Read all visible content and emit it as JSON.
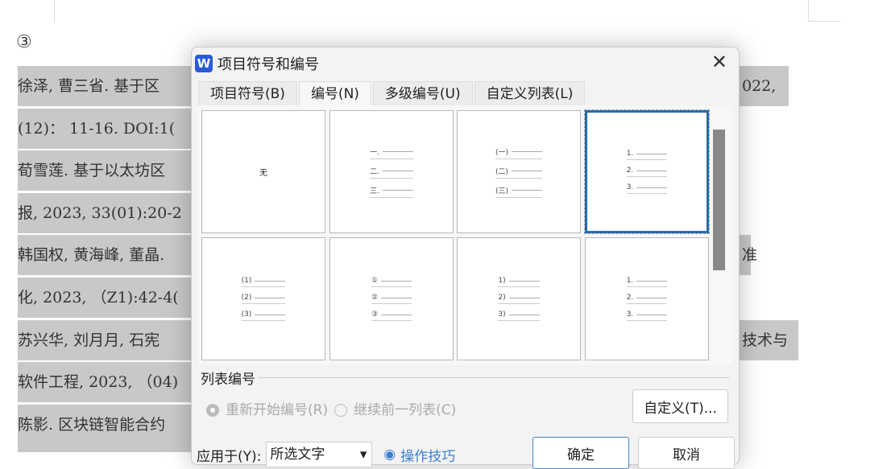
{
  "document": {
    "marker": "③",
    "lines": [
      "徐泽, 曹三省.  基于区",
      "(12)： 11-16.  DOI:1(",
      "荀雪莲. 基于以太坊区",
      "报, 2023, 33(01):20-2",
      "韩国权, 黄海峰, 董晶.",
      "化, 2023, （Z1):42-4(",
      "苏兴华, 刘月月, 石宪",
      "软件工程, 2023, （04)",
      "陈影. 区块链智能合约"
    ],
    "right_fragments": [
      "022,",
      "准",
      "技术与"
    ]
  },
  "dialog": {
    "title": "项目符号和编号",
    "app_icon_letter": "W",
    "tabs": [
      "项目符号(B)",
      "编号(N)",
      "多级编号(U)",
      "自定义列表(L)"
    ],
    "active_tab": "编号(N)",
    "none_label": "无",
    "presets": [
      [
        "一.",
        "二.",
        "三."
      ],
      [
        "(一)",
        "(二)",
        "(三)"
      ],
      [
        "1.",
        "2.",
        "3."
      ],
      [
        "(1)",
        "(2)",
        "(3)"
      ],
      [
        "①",
        "②",
        "③"
      ],
      [
        "1)",
        "2)",
        "3)"
      ],
      [
        "1.",
        "2.",
        "3."
      ]
    ],
    "section_label": "列表编号",
    "restart_label": "重新开始编号(R)",
    "continue_label": "继续前一列表(C)",
    "customize_label": "自定义(T)...",
    "apply_label": "应用于(Y):",
    "apply_value": "所选文字",
    "tips_label": "操作技巧",
    "ok_label": "确定",
    "cancel_label": "取消"
  }
}
